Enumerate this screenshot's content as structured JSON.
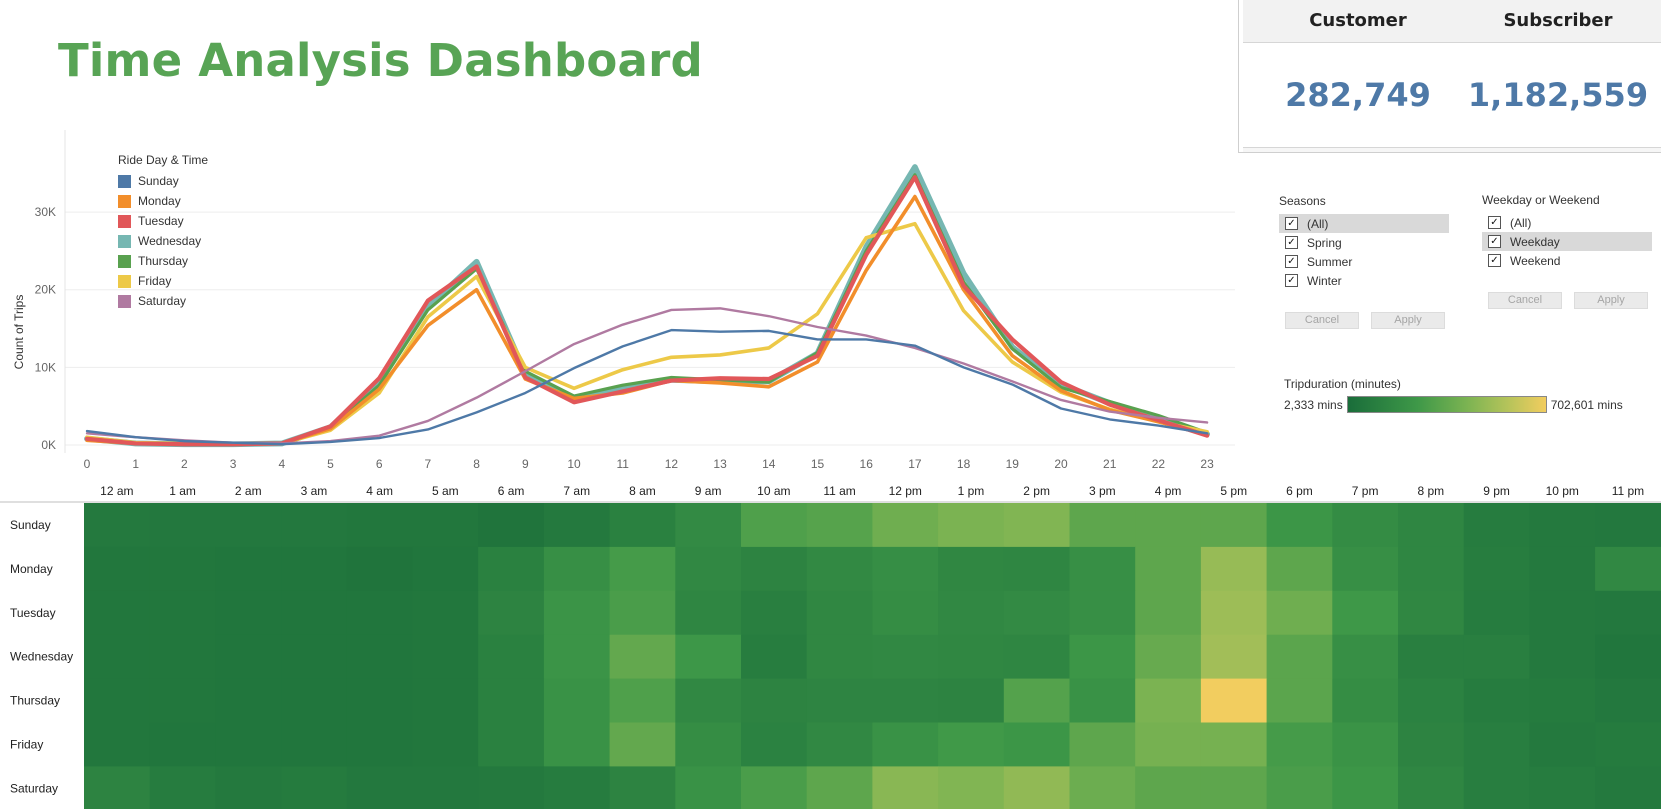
{
  "dashboard": {
    "title": "Time Analysis Dashboard",
    "kpis": [
      {
        "label": "Customer",
        "value": "282,749"
      },
      {
        "label": "Subscriber",
        "value": "1,182,559"
      }
    ],
    "filters": {
      "seasons": {
        "title": "Seasons",
        "options": [
          {
            "label": "(All)",
            "checked": true,
            "selected": true
          },
          {
            "label": "Spring",
            "checked": true,
            "selected": false
          },
          {
            "label": "Summer",
            "checked": true,
            "selected": false
          },
          {
            "label": "Winter",
            "checked": true,
            "selected": false
          }
        ],
        "cancel_label": "Cancel",
        "apply_label": "Apply"
      },
      "weekday_weekend": {
        "title": "Weekday or Weekend",
        "options": [
          {
            "label": "(All)",
            "checked": true,
            "selected": false
          },
          {
            "label": "Weekday",
            "checked": true,
            "selected": true
          },
          {
            "label": "Weekend",
            "checked": true,
            "selected": false
          }
        ],
        "cancel_label": "Cancel",
        "apply_label": "Apply"
      }
    },
    "color_legend": {
      "title": "Tripduration (minutes)",
      "min_label": "2,333 mins",
      "max_label": "702,601 mins",
      "colors": [
        "#1a6d3a",
        "#3e9848",
        "#7bb352",
        "#b3c35a",
        "#f2cd5f"
      ]
    }
  },
  "chart_data": [
    {
      "type": "line",
      "ylabel": "Count of Trips",
      "legend_title": "Ride Day & Time",
      "legend_placement": "top-left",
      "ylim": [
        0,
        38000
      ],
      "yticks": [
        0,
        10000,
        20000,
        30000
      ],
      "ytick_labels": [
        "0K",
        "10K",
        "20K",
        "30K"
      ],
      "x": [
        0,
        1,
        2,
        3,
        4,
        5,
        6,
        7,
        8,
        9,
        10,
        11,
        12,
        13,
        14,
        15,
        16,
        17,
        18,
        19,
        20,
        21,
        22,
        23
      ],
      "series": [
        {
          "name": "Sunday",
          "color": "#4e79a7",
          "values": [
            1800,
            1000,
            500,
            300,
            100,
            400,
            900,
            2000,
            4200,
            6700,
            9900,
            12700,
            14800,
            14600,
            14700,
            13600,
            13600,
            12800,
            10000,
            7800,
            4700,
            3300,
            2500,
            1500
          ]
        },
        {
          "name": "Monday",
          "color": "#f28e2b",
          "values": [
            600,
            200,
            100,
            100,
            200,
            2100,
            7200,
            15400,
            20000,
            8500,
            6000,
            6700,
            8300,
            8000,
            7500,
            10700,
            22500,
            32000,
            20000,
            11500,
            7000,
            4500,
            3000,
            1300
          ]
        },
        {
          "name": "Tuesday",
          "color": "#e15759",
          "values": [
            800,
            200,
            100,
            100,
            200,
            2400,
            8600,
            18600,
            23000,
            8700,
            5500,
            6900,
            8300,
            8600,
            8500,
            11500,
            24500,
            34500,
            20500,
            13600,
            8100,
            5200,
            3200,
            1200
          ]
        },
        {
          "name": "Wednesday",
          "color": "#76b7b2",
          "values": [
            800,
            200,
            100,
            100,
            200,
            2300,
            8000,
            17800,
            23600,
            9200,
            6000,
            7200,
            8400,
            8200,
            8200,
            11800,
            25500,
            35800,
            22100,
            12600,
            7800,
            5400,
            3500,
            1400
          ]
        },
        {
          "name": "Thursday",
          "color": "#59a14f",
          "values": [
            800,
            200,
            100,
            100,
            200,
            2200,
            7700,
            17400,
            22700,
            9500,
            6300,
            7700,
            8700,
            8400,
            8100,
            11900,
            25000,
            34800,
            21000,
            12400,
            7400,
            5600,
            3800,
            1600
          ]
        },
        {
          "name": "Friday",
          "color": "#edc948",
          "values": [
            1000,
            300,
            200,
            100,
            200,
            1900,
            6700,
            16500,
            21700,
            10000,
            7300,
            9700,
            11300,
            11600,
            12500,
            16900,
            26700,
            28500,
            17300,
            10700,
            6800,
            4600,
            3000,
            1700
          ]
        },
        {
          "name": "Saturday",
          "color": "#b07aa1",
          "values": [
            1500,
            1000,
            600,
            300,
            200,
            500,
            1200,
            3100,
            6100,
            9500,
            13000,
            15500,
            17400,
            17600,
            16600,
            15200,
            14100,
            12500,
            10500,
            8200,
            5800,
            4300,
            3500,
            2900
          ]
        }
      ]
    },
    {
      "type": "heatmap",
      "x_labels": [
        "12 am",
        "1 am",
        "2 am",
        "3 am",
        "4 am",
        "5 am",
        "6 am",
        "7 am",
        "8 am",
        "9 am",
        "10 am",
        "11 am",
        "12 pm",
        "1 pm",
        "2 pm",
        "3 pm",
        "4 pm",
        "5 pm",
        "6 pm",
        "7 pm",
        "8 pm",
        "9 pm",
        "10 pm",
        "11 pm"
      ],
      "y_labels": [
        "Sunday",
        "Monday",
        "Tuesday",
        "Wednesday",
        "Thursday",
        "Friday",
        "Saturday"
      ],
      "values": [
        [
          0.1,
          0.09,
          0.09,
          0.09,
          0.08,
          0.08,
          0.06,
          0.1,
          0.16,
          0.24,
          0.42,
          0.45,
          0.55,
          0.6,
          0.62,
          0.48,
          0.48,
          0.48,
          0.33,
          0.25,
          0.2,
          0.12,
          0.1,
          0.09
        ],
        [
          0.08,
          0.08,
          0.07,
          0.07,
          0.06,
          0.07,
          0.16,
          0.28,
          0.38,
          0.22,
          0.18,
          0.23,
          0.27,
          0.21,
          0.2,
          0.28,
          0.48,
          0.7,
          0.48,
          0.28,
          0.2,
          0.13,
          0.1,
          0.22
        ],
        [
          0.08,
          0.08,
          0.07,
          0.07,
          0.07,
          0.08,
          0.18,
          0.32,
          0.4,
          0.2,
          0.15,
          0.21,
          0.26,
          0.22,
          0.24,
          0.28,
          0.48,
          0.72,
          0.55,
          0.35,
          0.21,
          0.12,
          0.1,
          0.09
        ],
        [
          0.08,
          0.08,
          0.07,
          0.07,
          0.07,
          0.08,
          0.16,
          0.32,
          0.5,
          0.34,
          0.13,
          0.21,
          0.22,
          0.21,
          0.2,
          0.33,
          0.52,
          0.74,
          0.47,
          0.28,
          0.15,
          0.15,
          0.1,
          0.07
        ],
        [
          0.08,
          0.08,
          0.07,
          0.07,
          0.07,
          0.08,
          0.16,
          0.3,
          0.42,
          0.22,
          0.18,
          0.19,
          0.19,
          0.18,
          0.44,
          0.3,
          0.6,
          1.0,
          0.47,
          0.26,
          0.17,
          0.12,
          0.11,
          0.09
        ],
        [
          0.08,
          0.07,
          0.07,
          0.07,
          0.07,
          0.08,
          0.16,
          0.3,
          0.5,
          0.26,
          0.17,
          0.22,
          0.3,
          0.36,
          0.33,
          0.48,
          0.58,
          0.58,
          0.38,
          0.31,
          0.18,
          0.14,
          0.1,
          0.11
        ],
        [
          0.18,
          0.12,
          0.1,
          0.11,
          0.09,
          0.09,
          0.1,
          0.12,
          0.18,
          0.3,
          0.4,
          0.48,
          0.65,
          0.62,
          0.68,
          0.54,
          0.48,
          0.48,
          0.4,
          0.33,
          0.2,
          0.14,
          0.12,
          0.1
        ]
      ]
    }
  ]
}
